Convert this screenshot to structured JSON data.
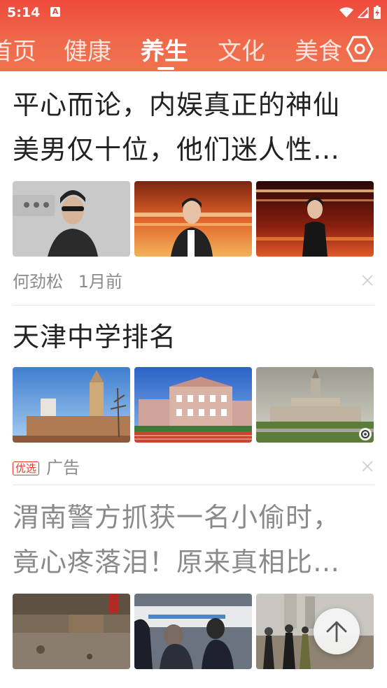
{
  "status_bar": {
    "time": "5:14"
  },
  "tabs": [
    {
      "label": "首页",
      "active": false
    },
    {
      "label": "健康",
      "active": false
    },
    {
      "label": "养生",
      "active": true
    },
    {
      "label": "文化",
      "active": false
    },
    {
      "label": "美食",
      "active": false
    }
  ],
  "feed": [
    {
      "title": "平心而论，内娱真正的神仙美男仅十位，他们迷人性…",
      "title_line1": "平心而论，内娱真正的神仙",
      "title_line2": "美男仅十位，他们迷人性…",
      "source": "何劲松",
      "time": "1月前",
      "images": [
        "man-sunglasses-photo",
        "singer-on-stage-photo",
        "performer-on-stage-photo"
      ]
    },
    {
      "title": "天津中学排名",
      "ad_badge": "优选",
      "ad_label": "广告",
      "images": [
        "church-tower-photo",
        "school-building-track-photo",
        "university-tower-photo"
      ]
    },
    {
      "title": "渭南警方抓获一名小偷时，竟心疼落泪！原来真相比…",
      "title_line1": "渭南警方抓获一名小偷时，",
      "title_line2": "竟心疼落泪！原来真相比…",
      "read": true,
      "images": [
        "rural-yard-photo",
        "people-crouching-photo",
        "people-outdoor-photo"
      ]
    }
  ],
  "colors": {
    "brand_red": "#ee4a3c",
    "ad_red": "#e53b2f"
  },
  "icons": {
    "settings": "settings-hexagon-icon",
    "close": "close-icon",
    "back_to_top": "arrow-up-icon"
  }
}
